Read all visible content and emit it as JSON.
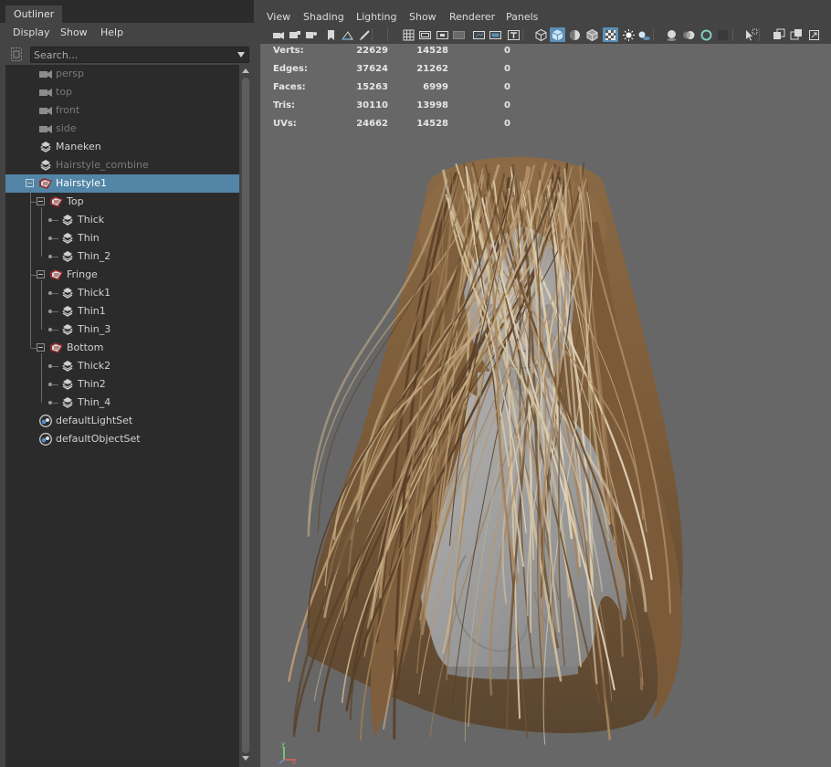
{
  "outliner": {
    "tab_label": "Outliner",
    "menu": [
      "Display",
      "Show",
      "Help"
    ],
    "search_placeholder": "Search...",
    "items": [
      {
        "label": "persp",
        "icon": "camera-icon",
        "dim": true
      },
      {
        "label": "top",
        "icon": "camera-icon",
        "dim": true
      },
      {
        "label": "front",
        "icon": "camera-icon",
        "dim": true
      },
      {
        "label": "side",
        "icon": "camera-icon",
        "dim": true
      },
      {
        "label": "Maneken",
        "icon": "mesh-icon",
        "dim": false
      },
      {
        "label": "Hairstyle_combine",
        "icon": "mesh-icon",
        "dim": true
      },
      {
        "label": "Hairstyle1",
        "icon": "group-icon",
        "dim": false,
        "selected": true
      },
      {
        "label": "Top",
        "icon": "group-icon",
        "dim": false
      },
      {
        "label": "Thick",
        "icon": "mesh-icon",
        "dim": false
      },
      {
        "label": "Thin",
        "icon": "mesh-icon",
        "dim": false
      },
      {
        "label": "Thin_2",
        "icon": "mesh-icon",
        "dim": false
      },
      {
        "label": "Fringe",
        "icon": "group-icon",
        "dim": false
      },
      {
        "label": "Thick1",
        "icon": "mesh-icon",
        "dim": false
      },
      {
        "label": "Thin1",
        "icon": "mesh-icon",
        "dim": false
      },
      {
        "label": "Thin_3",
        "icon": "mesh-icon",
        "dim": false
      },
      {
        "label": "Bottom",
        "icon": "group-icon",
        "dim": false
      },
      {
        "label": "Thick2",
        "icon": "mesh-icon",
        "dim": false
      },
      {
        "label": "Thin2",
        "icon": "mesh-icon",
        "dim": false
      },
      {
        "label": "Thin_4",
        "icon": "mesh-icon",
        "dim": false
      },
      {
        "label": "defaultLightSet",
        "icon": "set-icon",
        "dim": false
      },
      {
        "label": "defaultObjectSet",
        "icon": "set-icon",
        "dim": false
      }
    ]
  },
  "viewport": {
    "menu": [
      "View",
      "Shading",
      "Lighting",
      "Show",
      "Renderer",
      "Panels"
    ],
    "hud": [
      {
        "label": "Verts:",
        "v1": "22629",
        "v2": "14528",
        "v3": "0"
      },
      {
        "label": "Edges:",
        "v1": "37624",
        "v2": "21262",
        "v3": "0"
      },
      {
        "label": "Faces:",
        "v1": "15263",
        "v2": "6999",
        "v3": "0"
      },
      {
        "label": "Tris:",
        "v1": "30110",
        "v2": "13998",
        "v3": "0"
      },
      {
        "label": "UVs:",
        "v1": "24662",
        "v2": "14528",
        "v3": "0"
      }
    ],
    "axis_labels": {
      "y": "y",
      "x": "x"
    }
  },
  "colors": {
    "selection": "#5285a6",
    "toolbar_active": "#5b8fb5",
    "panel_bg": "#444444",
    "tree_bg": "#2b2b2b",
    "viewport_bg": "#676767"
  }
}
